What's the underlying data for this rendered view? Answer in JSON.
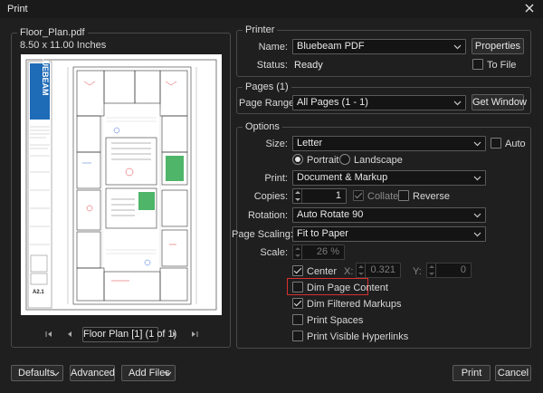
{
  "window": {
    "title": "Print",
    "close_icon": "close-icon"
  },
  "preview": {
    "file_name": "Floor_Plan.pdf",
    "page_size": "8.50  x  11.00 Inches",
    "page_selector": "Floor Plan [1] (1 of 1)",
    "logo_text": "BLUEBEAM",
    "sheet_number": "A2.1",
    "nav_icons": [
      "first-page-icon",
      "previous-page-icon",
      "next-page-icon",
      "last-page-icon"
    ]
  },
  "printer": {
    "group_title": "Printer",
    "name_label": "Name:",
    "name_value": "Bluebeam PDF",
    "properties_button": "Properties",
    "status_label": "Status:",
    "status_value": "Ready",
    "to_file_label": "To File",
    "to_file_checked": false
  },
  "pages": {
    "group_title": "Pages (1)",
    "range_label": "Page Range:",
    "range_value": "All Pages (1 - 1)",
    "get_window_button": "Get Window"
  },
  "options": {
    "group_title": "Options",
    "size_label": "Size:",
    "size_value": "Letter",
    "auto_label": "Auto",
    "auto_checked": false,
    "portrait_label": "Portrait",
    "portrait_selected": true,
    "landscape_label": "Landscape",
    "print_label": "Print:",
    "print_value": "Document & Markup",
    "copies_label": "Copies:",
    "copies_value": "1",
    "collate_label": "Collate",
    "collate_checked": true,
    "reverse_label": "Reverse",
    "reverse_checked": false,
    "rotation_label": "Rotation:",
    "rotation_value": "Auto Rotate 90",
    "scaling_label": "Page Scaling:",
    "scaling_value": "Fit to Paper",
    "scale_label": "Scale:",
    "scale_value": "26 %",
    "center_label": "Center",
    "center_checked": true,
    "x_label": "X:",
    "x_value": "0.321",
    "y_label": "Y:",
    "y_value": "0",
    "dim_page_label": "Dim Page Content",
    "dim_page_checked": false,
    "dim_filtered_label": "Dim Filtered Markups",
    "dim_filtered_checked": true,
    "print_spaces_label": "Print Spaces",
    "print_spaces_checked": false,
    "print_hyperlinks_label": "Print Visible Hyperlinks",
    "print_hyperlinks_checked": false
  },
  "footer": {
    "defaults_button": "Defaults",
    "advanced_button": "Advanced",
    "add_files_button": "Add Files",
    "print_button": "Print",
    "cancel_button": "Cancel"
  },
  "colors": {
    "background": "#1f1f1f",
    "highlight": "#d93030",
    "accent_green": "#2fa84f",
    "logo_blue": "#1e6bb8"
  }
}
